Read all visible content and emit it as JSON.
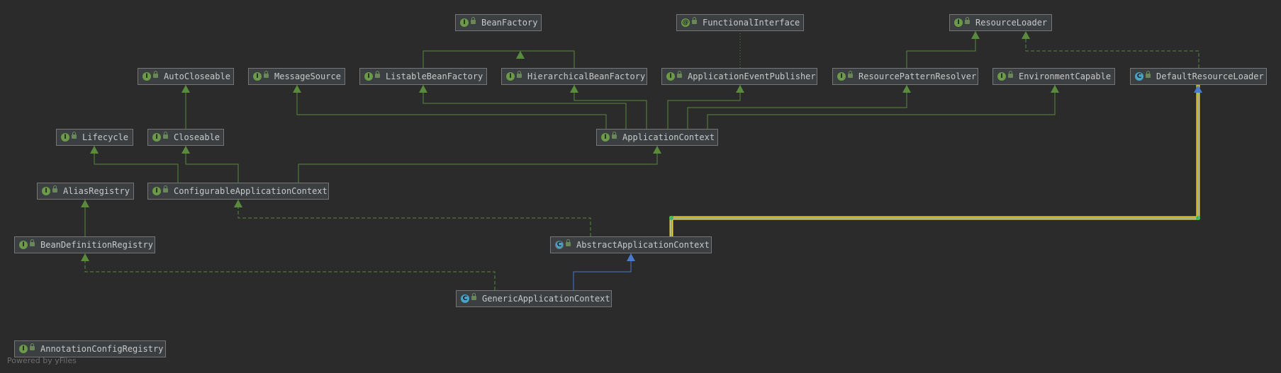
{
  "colors": {
    "background": "#2b2b2b",
    "node_fill": "#3c3f41",
    "node_border": "#767676",
    "interface_badge": "#6a9a4a",
    "class_badge": "#4aa3c6",
    "edge_green": "#5a8a3c",
    "edge_blue": "#4a7acb",
    "selection": "#e8d23a"
  },
  "nodes": [
    {
      "id": "BeanFactory",
      "label": "BeanFactory",
      "kind": "interface",
      "badge": "I"
    },
    {
      "id": "FunctionalInterface",
      "label": "FunctionalInterface",
      "kind": "annotation",
      "badge": "@"
    },
    {
      "id": "ResourceLoader",
      "label": "ResourceLoader",
      "kind": "interface",
      "badge": "I"
    },
    {
      "id": "AutoCloseable",
      "label": "AutoCloseable",
      "kind": "interface",
      "badge": "I"
    },
    {
      "id": "MessageSource",
      "label": "MessageSource",
      "kind": "interface",
      "badge": "I"
    },
    {
      "id": "ListableBeanFactory",
      "label": "ListableBeanFactory",
      "kind": "interface",
      "badge": "I"
    },
    {
      "id": "HierarchicalBeanFactory",
      "label": "HierarchicalBeanFactory",
      "kind": "interface",
      "badge": "I"
    },
    {
      "id": "ApplicationEventPublisher",
      "label": "ApplicationEventPublisher",
      "kind": "interface",
      "badge": "I"
    },
    {
      "id": "ResourcePatternResolver",
      "label": "ResourcePatternResolver",
      "kind": "interface",
      "badge": "I"
    },
    {
      "id": "EnvironmentCapable",
      "label": "EnvironmentCapable",
      "kind": "interface",
      "badge": "I"
    },
    {
      "id": "DefaultResourceLoader",
      "label": "DefaultResourceLoader",
      "kind": "class",
      "badge": "C"
    },
    {
      "id": "Lifecycle",
      "label": "Lifecycle",
      "kind": "interface",
      "badge": "I"
    },
    {
      "id": "Closeable",
      "label": "Closeable",
      "kind": "interface",
      "badge": "I"
    },
    {
      "id": "ApplicationContext",
      "label": "ApplicationContext",
      "kind": "interface",
      "badge": "I"
    },
    {
      "id": "AliasRegistry",
      "label": "AliasRegistry",
      "kind": "interface",
      "badge": "I"
    },
    {
      "id": "ConfigurableApplicationContext",
      "label": "ConfigurableApplicationContext",
      "kind": "interface",
      "badge": "I"
    },
    {
      "id": "BeanDefinitionRegistry",
      "label": "BeanDefinitionRegistry",
      "kind": "interface",
      "badge": "I"
    },
    {
      "id": "AbstractApplicationContext",
      "label": "AbstractApplicationContext",
      "kind": "abstract",
      "badge": "C"
    },
    {
      "id": "GenericApplicationContext",
      "label": "GenericApplicationContext",
      "kind": "class",
      "badge": "C"
    },
    {
      "id": "AnnotationConfigRegistry",
      "label": "AnnotationConfigRegistry",
      "kind": "interface",
      "badge": "I"
    }
  ],
  "edges": [
    {
      "from": "ListableBeanFactory",
      "to": "BeanFactory",
      "type": "extends"
    },
    {
      "from": "HierarchicalBeanFactory",
      "to": "BeanFactory",
      "type": "extends"
    },
    {
      "from": "ApplicationEventPublisher",
      "to": "FunctionalInterface",
      "type": "annotated"
    },
    {
      "from": "ResourcePatternResolver",
      "to": "ResourceLoader",
      "type": "extends"
    },
    {
      "from": "DefaultResourceLoader",
      "to": "ResourceLoader",
      "type": "implements"
    },
    {
      "from": "Closeable",
      "to": "AutoCloseable",
      "type": "extends"
    },
    {
      "from": "ApplicationContext",
      "to": "MessageSource",
      "type": "extends"
    },
    {
      "from": "ApplicationContext",
      "to": "ListableBeanFactory",
      "type": "extends"
    },
    {
      "from": "ApplicationContext",
      "to": "HierarchicalBeanFactory",
      "type": "extends"
    },
    {
      "from": "ApplicationContext",
      "to": "ApplicationEventPublisher",
      "type": "extends"
    },
    {
      "from": "ApplicationContext",
      "to": "ResourcePatternResolver",
      "type": "extends"
    },
    {
      "from": "ApplicationContext",
      "to": "EnvironmentCapable",
      "type": "extends"
    },
    {
      "from": "ConfigurableApplicationContext",
      "to": "Lifecycle",
      "type": "extends"
    },
    {
      "from": "ConfigurableApplicationContext",
      "to": "Closeable",
      "type": "extends"
    },
    {
      "from": "ConfigurableApplicationContext",
      "to": "ApplicationContext",
      "type": "extends"
    },
    {
      "from": "BeanDefinitionRegistry",
      "to": "AliasRegistry",
      "type": "extends"
    },
    {
      "from": "AbstractApplicationContext",
      "to": "ConfigurableApplicationContext",
      "type": "implements"
    },
    {
      "from": "AbstractApplicationContext",
      "to": "DefaultResourceLoader",
      "type": "extends",
      "selected": true
    },
    {
      "from": "GenericApplicationContext",
      "to": "AbstractApplicationContext",
      "type": "extends"
    },
    {
      "from": "GenericApplicationContext",
      "to": "BeanDefinitionRegistry",
      "type": "implements"
    }
  ],
  "footer": "Powered by yFiles"
}
